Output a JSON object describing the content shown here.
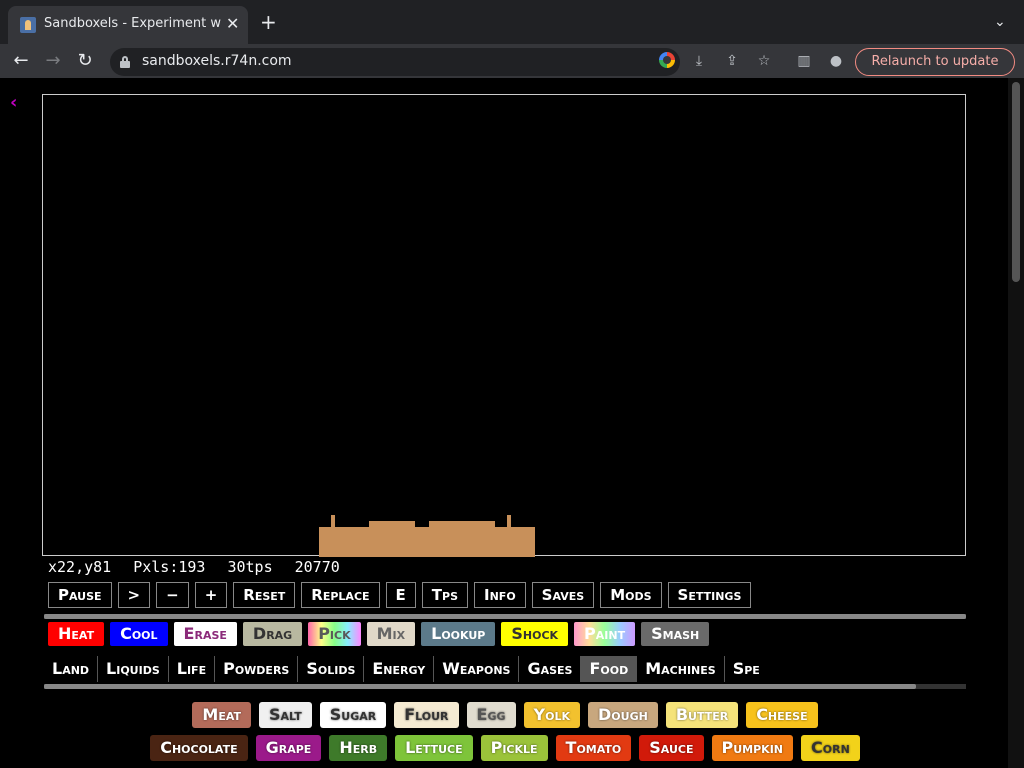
{
  "browser": {
    "tab_title": "Sandboxels - Experiment with",
    "tab_close": "✕",
    "new_tab": "+",
    "tab_list": "⌄",
    "url": "sandboxels.r74n.com",
    "relaunch_label": "Relaunch to update"
  },
  "page": {
    "back_icon": "‹"
  },
  "stats": {
    "coords": "x22,y81",
    "pixels": "Pxls:193",
    "tps": "30tps",
    "ticks": "20770"
  },
  "controls": [
    {
      "label": "Pause"
    },
    {
      "label": ">"
    },
    {
      "label": "−"
    },
    {
      "label": "+"
    },
    {
      "label": "Reset"
    },
    {
      "label": "Replace"
    },
    {
      "label": "E"
    },
    {
      "label": "Tps"
    },
    {
      "label": "Info"
    },
    {
      "label": "Saves"
    },
    {
      "label": "Mods"
    },
    {
      "label": "Settings"
    }
  ],
  "tools": [
    {
      "label": "Heat",
      "bg": "#ff0000",
      "fg": "#ffffff"
    },
    {
      "label": "Cool",
      "bg": "#0000ff",
      "fg": "#ffffff"
    },
    {
      "label": "Erase",
      "bg": "#ffffff",
      "fg": "#8b2a7a"
    },
    {
      "label": "Drag",
      "bg": "#b8b8a0",
      "fg": "#333333"
    },
    {
      "label": "Pick",
      "bg": "linear-gradient(90deg,#f6a,#ff8,#8f8,#8ef,#f8f)",
      "fg": "#5a5a5a"
    },
    {
      "label": "Mix",
      "bg": "#e0d8c8",
      "fg": "#666666"
    },
    {
      "label": "Lookup",
      "bg": "#5c7a8a",
      "fg": "#ffffff"
    },
    {
      "label": "Shock",
      "bg": "#ffff00",
      "fg": "#333333"
    },
    {
      "label": "Paint",
      "bg": "linear-gradient(90deg,#f9c,#fd9,#9f9,#9cf,#c9f)",
      "fg": "#ffffff"
    },
    {
      "label": "Smash",
      "bg": "#6a6a6a",
      "fg": "#ffffff"
    }
  ],
  "categories": [
    {
      "label": "Land"
    },
    {
      "label": "Liquids"
    },
    {
      "label": "Life"
    },
    {
      "label": "Powders"
    },
    {
      "label": "Solids"
    },
    {
      "label": "Energy"
    },
    {
      "label": "Weapons"
    },
    {
      "label": "Gases"
    },
    {
      "label": "Food",
      "active": true
    },
    {
      "label": "Machines"
    },
    {
      "label": "Spe"
    }
  ],
  "foods": [
    [
      {
        "label": "Meat",
        "bg": "#b36b5a",
        "fg": "#ffffff"
      },
      {
        "label": "Salt",
        "bg": "#f0f0f0",
        "fg": "#333333"
      },
      {
        "label": "Sugar",
        "bg": "#ffffff",
        "fg": "#333333"
      },
      {
        "label": "Flour",
        "bg": "#f5ebd2",
        "fg": "#333333"
      },
      {
        "label": "Egg",
        "bg": "#e0dccf",
        "fg": "#555555"
      },
      {
        "label": "Yolk",
        "bg": "#f2c12e",
        "fg": "#ffffff"
      },
      {
        "label": "Dough",
        "bg": "#c8a77e",
        "fg": "#ffffff"
      },
      {
        "label": "Butter",
        "bg": "#f5e37a",
        "fg": "#ffffff"
      },
      {
        "label": "Cheese",
        "bg": "#f7c21c",
        "fg": "#ffffff"
      }
    ],
    [
      {
        "label": "Chocolate",
        "bg": "#4a2413",
        "fg": "#ffffff"
      },
      {
        "label": "Grape",
        "bg": "#9b1a8a",
        "fg": "#ffffff"
      },
      {
        "label": "Herb",
        "bg": "#3e7a2a",
        "fg": "#ffffff"
      },
      {
        "label": "Lettuce",
        "bg": "#7ec43a",
        "fg": "#ffffff"
      },
      {
        "label": "Pickle",
        "bg": "#9bc33a",
        "fg": "#ffffff"
      },
      {
        "label": "Tomato",
        "bg": "#e23a12",
        "fg": "#ffffff"
      },
      {
        "label": "Sauce",
        "bg": "#d11a0a",
        "fg": "#ffffff"
      },
      {
        "label": "Pumpkin",
        "bg": "#f07a12",
        "fg": "#ffffff"
      },
      {
        "label": "Corn",
        "bg": "#f2d21a",
        "fg": "#333333"
      }
    ]
  ],
  "colors": {
    "sand": "#c8905a",
    "sand_dark": "#b87d48"
  }
}
